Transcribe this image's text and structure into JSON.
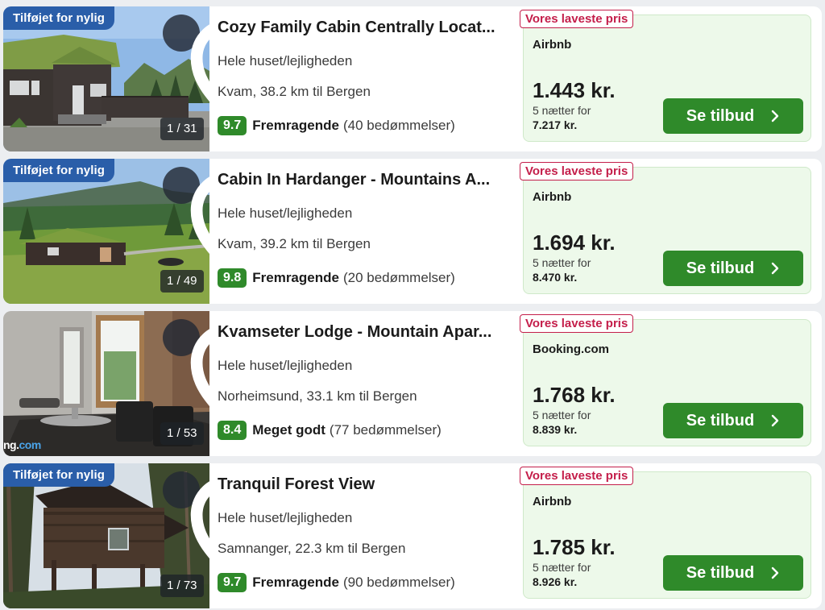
{
  "listings": [
    {
      "badge": "Tilføjet for nylig",
      "photo_counter": "1 / 31",
      "title": "Cozy Family Cabin Centrally Locat...",
      "type": "Hele huset/lejligheden",
      "location": "Kvam, 38.2 km til Bergen",
      "score": "9.7",
      "rating_text": "Fremragende",
      "reviews": "(40 bedømmelser)",
      "lowest_price_tag": "Vores laveste pris",
      "provider": "Airbnb",
      "price": "1.443 kr.",
      "nights": "5 nætter for",
      "total": "7.217 kr.",
      "cta": "Se tilbud"
    },
    {
      "badge": "Tilføjet for nylig",
      "photo_counter": "1 / 49",
      "title": "Cabin In Hardanger - Mountains A...",
      "type": "Hele huset/lejligheden",
      "location": "Kvam, 39.2 km til Bergen",
      "score": "9.8",
      "rating_text": "Fremragende",
      "reviews": "(20 bedømmelser)",
      "lowest_price_tag": "Vores laveste pris",
      "provider": "Airbnb",
      "price": "1.694 kr.",
      "nights": "5 nætter for",
      "total": "8.470 kr.",
      "cta": "Se tilbud"
    },
    {
      "badge": "",
      "photo_counter": "1 / 53",
      "watermark_a": "ng.",
      "watermark_b": "com",
      "title": "Kvamseter Lodge - Mountain Apar...",
      "type": "Hele huset/lejligheden",
      "location": "Norheimsund, 33.1 km til Bergen",
      "score": "8.4",
      "rating_text": "Meget godt",
      "reviews": "(77 bedømmelser)",
      "lowest_price_tag": "Vores laveste pris",
      "provider": "Booking.com",
      "price": "1.768 kr.",
      "nights": "5 nætter for",
      "total": "8.839 kr.",
      "cta": "Se tilbud"
    },
    {
      "badge": "Tilføjet for nylig",
      "photo_counter": "1 / 73",
      "title": "Tranquil Forest View",
      "type": "Hele huset/lejligheden",
      "location": "Samnanger, 22.3 km til Bergen",
      "score": "9.7",
      "rating_text": "Fremragende",
      "reviews": "(90 bedømmelser)",
      "lowest_price_tag": "Vores laveste pris",
      "provider": "Airbnb",
      "price": "1.785 kr.",
      "nights": "5 nætter for",
      "total": "8.926 kr.",
      "cta": "Se tilbud"
    }
  ],
  "icons": {
    "favorite": "heart-outline-icon",
    "next": "chevron-right-icon"
  },
  "colors": {
    "score_green": "#2f8a2a",
    "badge_blue": "#2a5ea9",
    "lowest_price_red": "#c41e4a",
    "offer_bg": "#edf9ea"
  }
}
